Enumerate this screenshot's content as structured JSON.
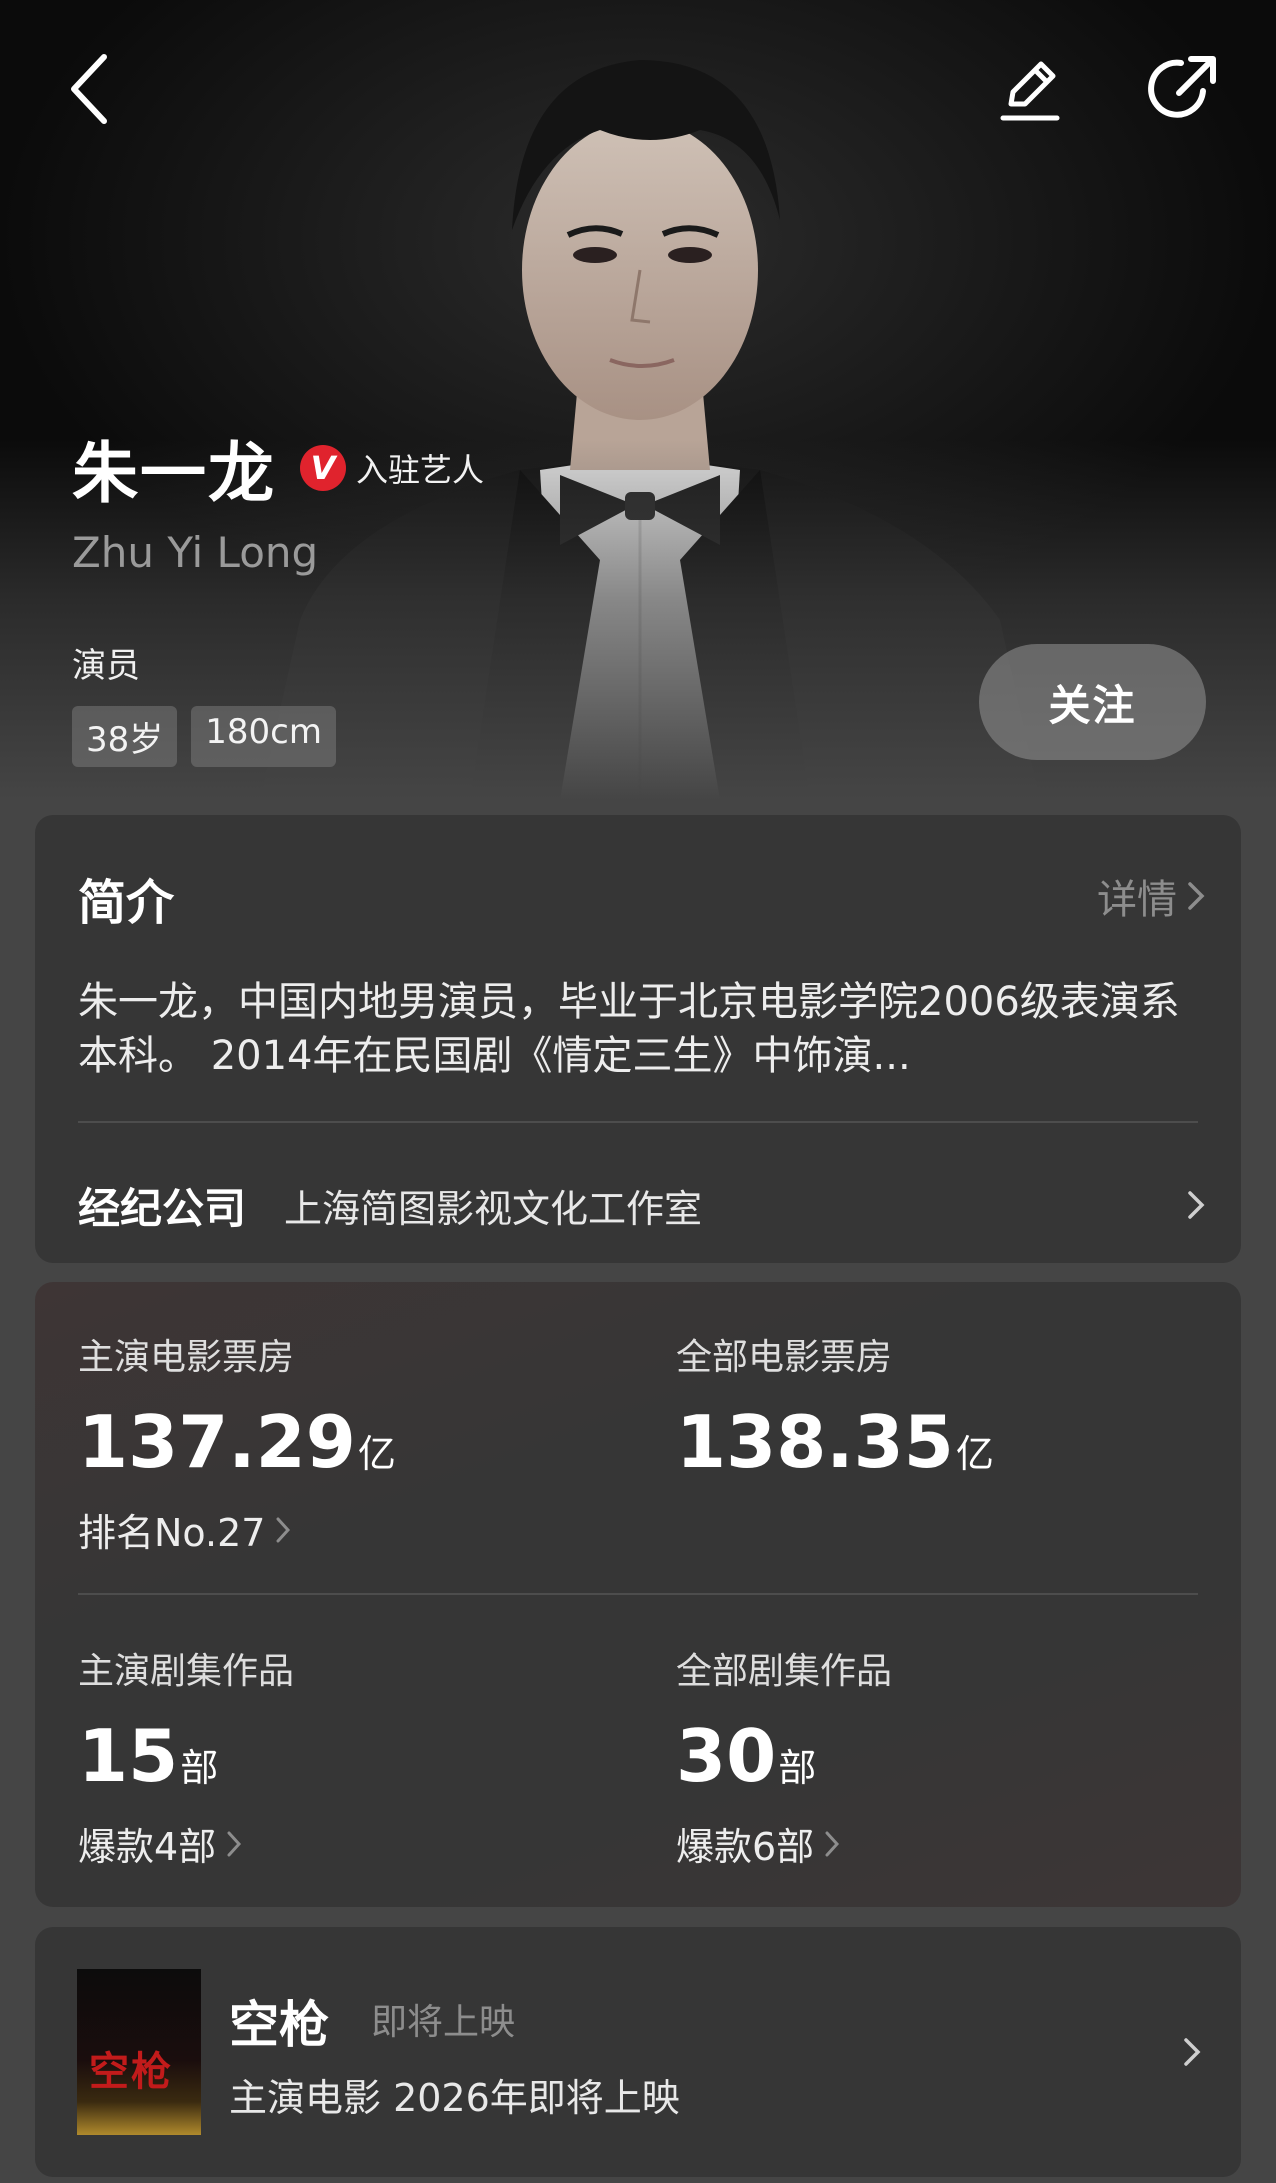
{
  "header": {
    "icons": [
      "back-icon",
      "edit-icon",
      "share-icon"
    ]
  },
  "profile": {
    "name_cn": "朱一龙",
    "verified_badge": "V",
    "verified_label": "入驻艺人",
    "name_en": "Zhu Yi Long",
    "profession": "演员",
    "tags": [
      "38岁",
      "180cm"
    ],
    "follow_label": "关注"
  },
  "intro": {
    "title": "简介",
    "detail_label": "详情",
    "text": "朱一龙，中国内地男演员，毕业于北京电影学院2006级表演系本科。 2014年在民国剧《情定三生》中饰演...",
    "agency_label": "经纪公司",
    "agency_value": "上海简图影视文化工作室"
  },
  "stats": {
    "lead_movie_box": {
      "label": "主演电影票房",
      "value": "137.29",
      "unit": "亿",
      "sub": "排名No.27"
    },
    "all_movie_box": {
      "label": "全部电影票房",
      "value": "138.35",
      "unit": "亿"
    },
    "lead_series": {
      "label": "主演剧集作品",
      "value": "15",
      "unit": "部",
      "sub": "爆款4部"
    },
    "all_series": {
      "label": "全部剧集作品",
      "value": "30",
      "unit": "部",
      "sub": "爆款6部"
    }
  },
  "upcoming": {
    "poster_text": "空枪",
    "title": "空枪",
    "status": "即将上映",
    "info": "主演电影 2026年即将上映"
  },
  "colors": {
    "background": "#454545",
    "card": "#363636",
    "verified_red": "#e0232d",
    "muted_text": "#8d8d8d"
  }
}
